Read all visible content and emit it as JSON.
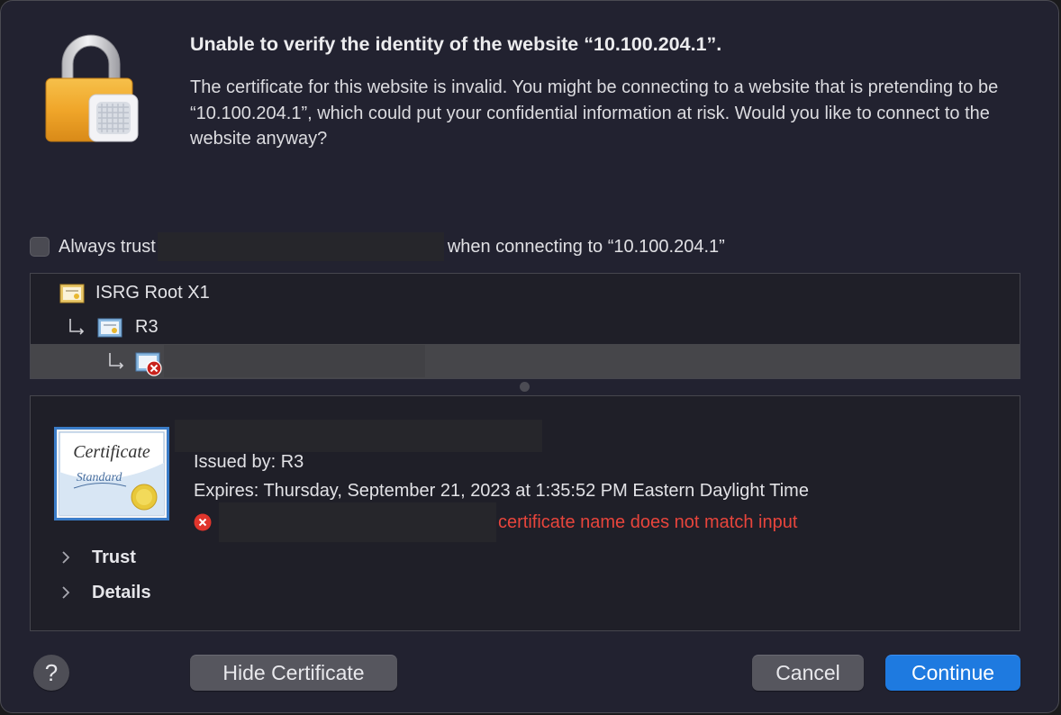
{
  "dialog": {
    "title": "Unable to verify the identity of the website “10.100.204.1”.",
    "message": "The certificate for this website is invalid. You might be connecting to a website that is pretending to be “10.100.204.1”, which could put your confidential information at risk. Would you like to connect to the website anyway?"
  },
  "trust_option": {
    "prefix": "Always trust",
    "suffix": "when connecting to “10.100.204.1”",
    "checked": false
  },
  "chain": {
    "items": [
      {
        "label": "ISRG Root X1"
      },
      {
        "label": "R3"
      },
      {
        "label": ""
      }
    ]
  },
  "certificate": {
    "issued_by": "Issued by: R3",
    "expires": "Expires: Thursday, September 21, 2023 at 1:35:52 PM Eastern Daylight Time",
    "error": "certificate name does not match input",
    "sections": [
      "Trust",
      "Details"
    ]
  },
  "buttons": {
    "help": "?",
    "hide_certificate": "Hide Certificate",
    "cancel": "Cancel",
    "continue": "Continue"
  },
  "colors": {
    "accent": "#1e7ae0",
    "error": "#e8453c",
    "background": "#222230"
  }
}
